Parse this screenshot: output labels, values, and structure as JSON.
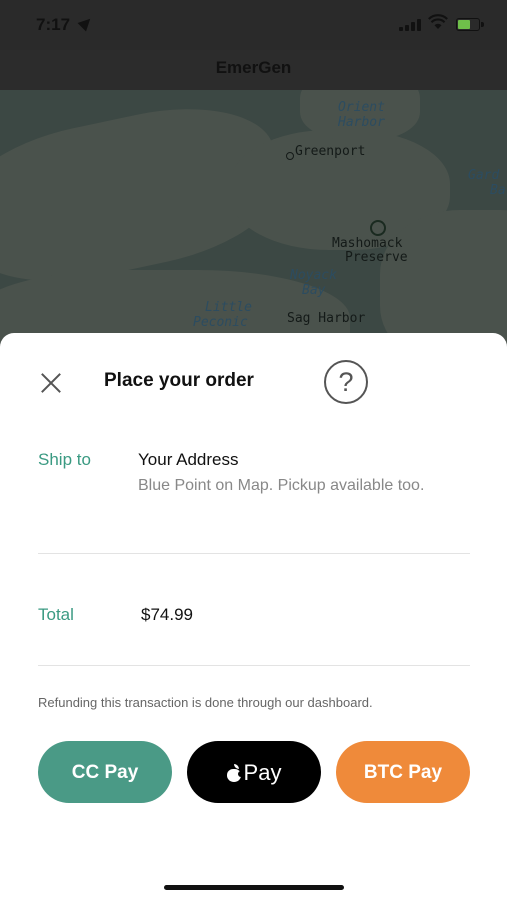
{
  "status_bar": {
    "time": "7:17"
  },
  "header": {
    "title": "EmerGen"
  },
  "map": {
    "labels": {
      "orient_harbor_1": "Orient",
      "orient_harbor_2": "Harbor",
      "greenport": "Greenport",
      "gardiners_1": "Gard",
      "gardiners_2": "Ba",
      "mashomack_1": "Mashomack",
      "mashomack_2": "Preserve",
      "noyack_1": "Noyack",
      "noyack_2": "Bay",
      "little_peconic_1": "Little",
      "little_peconic_2": "Peconic",
      "sag_harbor": "Sag Harbor"
    }
  },
  "order": {
    "title": "Place your order",
    "help_symbol": "?",
    "ship_to_label": "Ship to",
    "address_title": "Your Address",
    "address_desc": "Blue Point on Map. Pickup available too.",
    "total_label": "Total",
    "total_value": "$74.99",
    "refund_note": "Refunding this transaction is done through our dashboard."
  },
  "buttons": {
    "cc_pay": "CC Pay",
    "apple_pay": "Pay",
    "btc_pay": "BTC Pay"
  },
  "colors": {
    "accent": "#3a9a82",
    "cc_button": "#4a9a86",
    "btc_button": "#ef8a3a",
    "apple_button": "#000000"
  }
}
